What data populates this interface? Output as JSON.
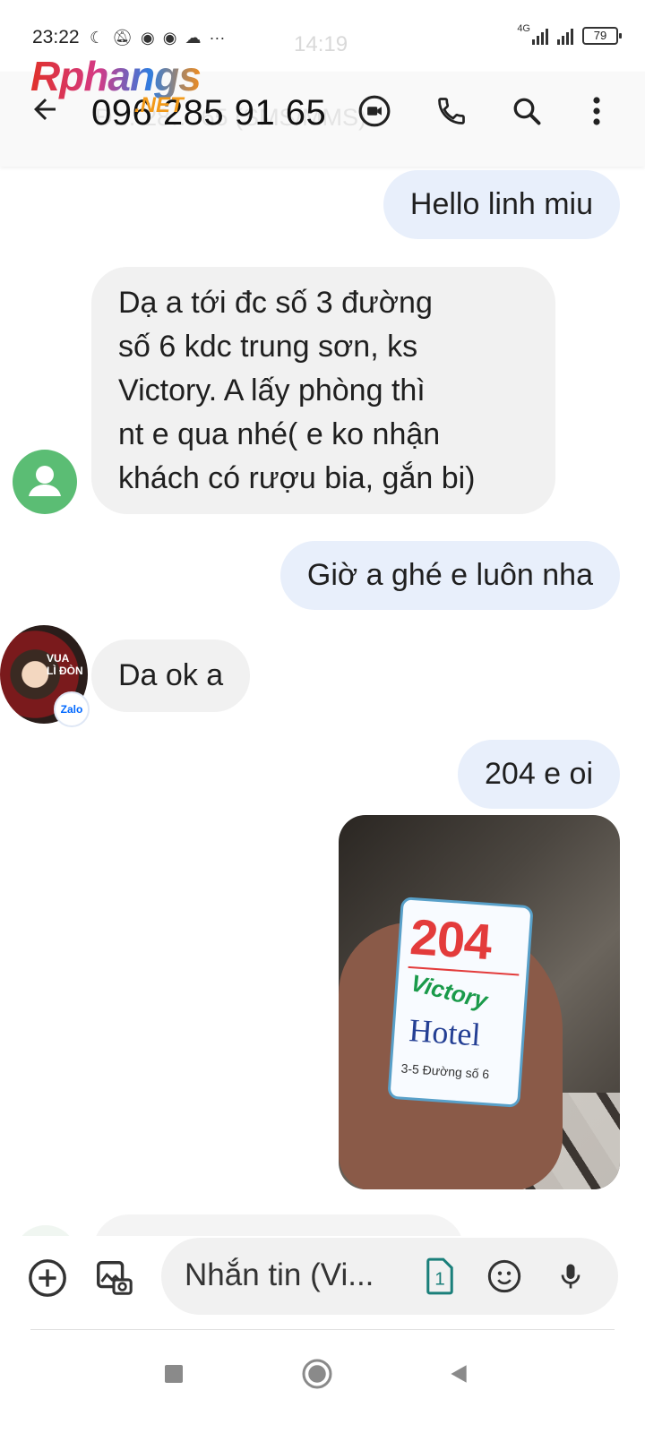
{
  "status_bar": {
    "time": "23:22",
    "ghost_time": "14:19",
    "network_type": "4G",
    "battery": "79"
  },
  "header": {
    "ghost_text": "Đ…        28…  65 (SMS/MMS)",
    "phone_number": "096 285 91 65",
    "watermark_main": "Rphangs",
    "watermark_suffix": ".NET"
  },
  "messages": [
    {
      "direction": "outgoing",
      "text": "Hello linh miu"
    },
    {
      "direction": "incoming",
      "text": " Dạ a tới đc số 3 đường\nsố 6 kdc trung sơn, ks\nVictory. A lấy phòng thì\nnt e qua nhé( e ko nhận\nkhách có rượu bia, gắn bi)"
    },
    {
      "direction": "outgoing",
      "text": "Giờ a ghé e luôn nha"
    },
    {
      "direction": "incoming",
      "text": "Da ok a"
    },
    {
      "direction": "outgoing",
      "text": "204 e oi"
    }
  ],
  "avatar": {
    "overlay_text_1": "VUA",
    "overlay_text_2": "LÌ ĐÒN",
    "badge": "Zalo"
  },
  "photo_card": {
    "room": "204",
    "brand": "Victory",
    "hotel": "Hotel",
    "address": "3-5 Đường số 6"
  },
  "compose": {
    "placeholder": "Nhắn tin (Vi...",
    "sim_slot": "1"
  },
  "colors": {
    "outgoing_bubble": "#e8effb",
    "incoming_bubble": "#f1f1f1",
    "avatar_green": "#5bbd74",
    "accent_teal": "#1a7f7a"
  }
}
